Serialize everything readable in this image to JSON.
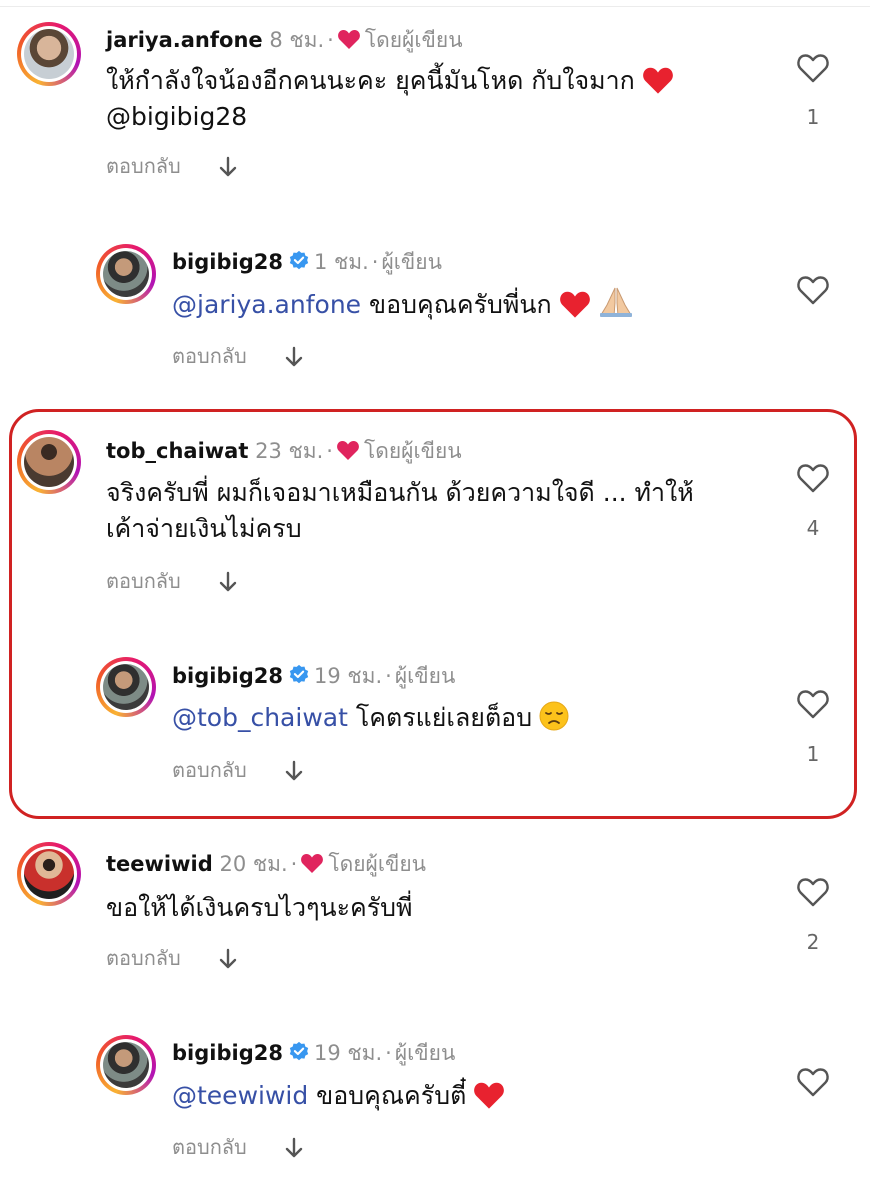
{
  "comments": [
    {
      "username": "jariya.anfone",
      "time": "8 ชม.",
      "author_label": "โดยผู้เขียน",
      "text": "ให้กำลังใจน้องอีกคนนะคะ  ยุคนี้มันโหด กับใจมาก",
      "text_line2": "@bigibig28",
      "reply_label": "ตอบกลับ",
      "like_count": "1",
      "reply": {
        "username": "bigibig28",
        "time": "1 ชม.",
        "author_label": "ผู้เขียน",
        "mention": "@jariya.anfone",
        "text": " ขอบคุณครับพี่นก",
        "reply_label": "ตอบกลับ",
        "like_count": ""
      }
    },
    {
      "username": "tob_chaiwat",
      "time": "23 ชม.",
      "author_label": "โดยผู้เขียน",
      "text": "จริงครับพี่ ผมก็เจอมาเหมือนกัน ด้วยความใจดี ... ทำให้",
      "text_line2": "เค้าจ่ายเงินไม่ครบ",
      "reply_label": "ตอบกลับ",
      "like_count": "4",
      "reply": {
        "username": "bigibig28",
        "time": "19 ชม.",
        "author_label": "ผู้เขียน",
        "mention": "@tob_chaiwat",
        "text": " โคตรแย่เลยต็อบ",
        "reply_label": "ตอบกลับ",
        "like_count": "1"
      }
    },
    {
      "username": "teewiwid",
      "time": "20 ชม.",
      "author_label": "โดยผู้เขียน",
      "text": "ขอให้ได้เงินครบไวๆนะครับพี่",
      "text_line2": "",
      "reply_label": "ตอบกลับ",
      "like_count": "2",
      "reply": {
        "username": "bigibig28",
        "time": "19 ชม.",
        "author_label": "ผู้เขียน",
        "mention": "@teewiwid",
        "text": " ขอบคุณครับตี๋",
        "reply_label": "ตอบกลับ",
        "like_count": ""
      }
    }
  ],
  "colors": {
    "mention": "#3750a6",
    "heart": "#e0245e",
    "verified": "#3897f0",
    "highlight_border": "#d02222",
    "muted": "#8e8e8e"
  },
  "icons": {
    "like": "heart-outline-icon",
    "author_liked": "heart-filled-icon",
    "verified": "verified-badge-icon",
    "expand": "arrow-down-icon"
  }
}
